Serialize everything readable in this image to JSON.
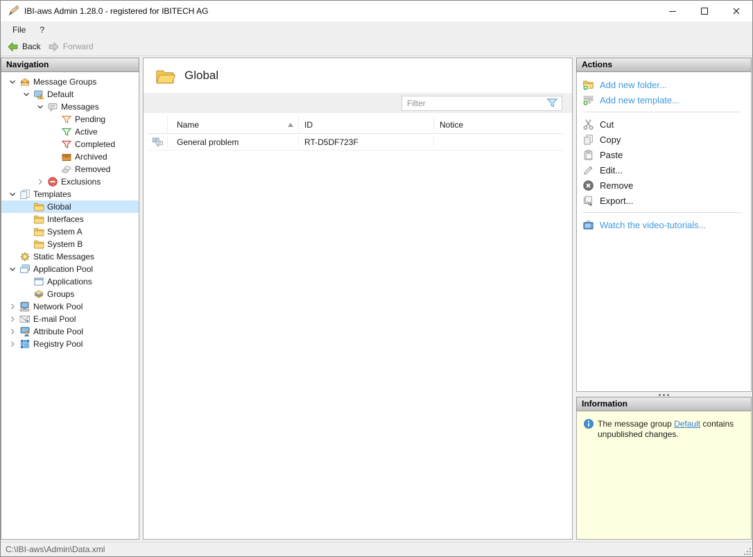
{
  "window": {
    "title": "IBI-aws Admin 1.28.0 - registered for IBITECH AG",
    "app_icon": "stamp-tool-icon",
    "controls": [
      {
        "name": "minimize-button",
        "icon": "minimize-icon"
      },
      {
        "name": "maximize-button",
        "icon": "maximize-icon"
      },
      {
        "name": "close-button",
        "icon": "close-icon"
      }
    ]
  },
  "menu": {
    "items": [
      {
        "label": "File"
      },
      {
        "label": "?"
      }
    ]
  },
  "toolbar": {
    "buttons": [
      {
        "label": "Back",
        "icon": "back-icon",
        "enabled": true
      },
      {
        "label": "Forward",
        "icon": "forward-icon",
        "enabled": false
      }
    ]
  },
  "navigation": {
    "header": "Navigation",
    "tree": [
      {
        "label": "Message Groups",
        "icon": "message-groups-icon",
        "level": 0,
        "expander": "expanded"
      },
      {
        "label": "Default",
        "icon": "default-group-icon",
        "level": 1,
        "expander": "expanded"
      },
      {
        "label": "Messages",
        "icon": "messages-icon",
        "level": 2,
        "expander": "expanded"
      },
      {
        "label": "Pending",
        "icon": "pending-filter-icon",
        "level": 3,
        "expander": "none"
      },
      {
        "label": "Active",
        "icon": "active-filter-icon",
        "level": 3,
        "expander": "none"
      },
      {
        "label": "Completed",
        "icon": "completed-filter-icon",
        "level": 3,
        "expander": "none"
      },
      {
        "label": "Archived",
        "icon": "archived-icon",
        "level": 3,
        "expander": "none"
      },
      {
        "label": "Removed",
        "icon": "removed-icon",
        "level": 3,
        "expander": "none"
      },
      {
        "label": "Exclusions",
        "icon": "exclusions-icon",
        "level": 2,
        "expander": "collapsed"
      },
      {
        "label": "Templates",
        "icon": "templates-icon",
        "level": 0,
        "expander": "expanded"
      },
      {
        "label": "Global",
        "icon": "folder-icon",
        "level": 1,
        "expander": "none",
        "selected": true
      },
      {
        "label": "Interfaces",
        "icon": "folder-icon",
        "level": 1,
        "expander": "none"
      },
      {
        "label": "System A",
        "icon": "folder-icon",
        "level": 1,
        "expander": "none"
      },
      {
        "label": "System B",
        "icon": "folder-icon",
        "level": 1,
        "expander": "none"
      },
      {
        "label": "Static Messages",
        "icon": "static-messages-icon",
        "level": 0,
        "expander": "none"
      },
      {
        "label": "Application Pool",
        "icon": "application-pool-icon",
        "level": 0,
        "expander": "expanded"
      },
      {
        "label": "Applications",
        "icon": "applications-icon",
        "level": 1,
        "expander": "none"
      },
      {
        "label": "Groups",
        "icon": "groups-icon",
        "level": 1,
        "expander": "none"
      },
      {
        "label": "Network Pool",
        "icon": "network-pool-icon",
        "level": 0,
        "expander": "collapsed"
      },
      {
        "label": "E-mail Pool",
        "icon": "email-pool-icon",
        "level": 0,
        "expander": "collapsed"
      },
      {
        "label": "Attribute Pool",
        "icon": "attribute-pool-icon",
        "level": 0,
        "expander": "collapsed"
      },
      {
        "label": "Registry Pool",
        "icon": "registry-pool-icon",
        "level": 0,
        "expander": "collapsed"
      }
    ]
  },
  "main": {
    "title": "Global",
    "title_icon": "folder-open-icon",
    "filter_placeholder": "Filter",
    "filter_icon": "filter-funnel-icon",
    "table": {
      "columns": [
        {
          "label": "Name",
          "sort": "asc"
        },
        {
          "label": "ID",
          "sort": "none"
        },
        {
          "label": "Notice",
          "sort": "none"
        }
      ],
      "rows": [
        {
          "icon": "message-row-icon",
          "name": "General problem",
          "id": "RT-D5DF723F",
          "notice": ""
        }
      ]
    }
  },
  "actions": {
    "header": "Actions",
    "items": [
      {
        "label": "Add new folder...",
        "icon": "add-folder-icon",
        "kind": "link"
      },
      {
        "label": "Add new template...",
        "icon": "add-template-icon",
        "kind": "link"
      },
      {
        "kind": "separator"
      },
      {
        "label": "Cut",
        "icon": "cut-icon",
        "kind": "normal"
      },
      {
        "label": "Copy",
        "icon": "copy-icon",
        "kind": "normal"
      },
      {
        "label": "Paste",
        "icon": "paste-icon",
        "kind": "normal"
      },
      {
        "label": "Edit...",
        "icon": "edit-icon",
        "kind": "normal"
      },
      {
        "label": "Remove",
        "icon": "remove-icon",
        "kind": "normal"
      },
      {
        "label": "Export...",
        "icon": "export-icon",
        "kind": "normal"
      },
      {
        "kind": "separator"
      },
      {
        "label": "Watch the video-tutorials...",
        "icon": "tv-icon",
        "kind": "link"
      }
    ]
  },
  "information": {
    "header": "Information",
    "icon": "info-icon",
    "text_before": "The message group ",
    "link": "Default",
    "text_after": " contains unpublished changes."
  },
  "statusbar": {
    "path": "C:\\IBI-aws\\Admin\\Data.xml"
  }
}
